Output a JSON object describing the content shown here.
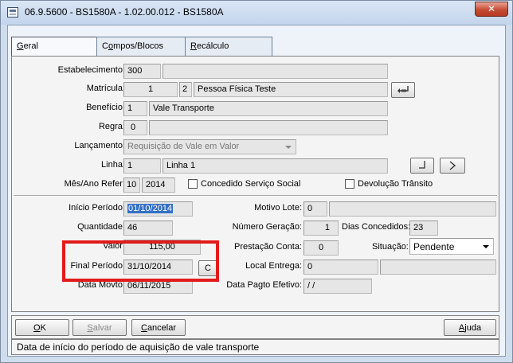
{
  "window": {
    "title": "06.9.5600 - BS1580A - 1.02.00.012 - BS1580A",
    "close": "✕"
  },
  "tabs": [
    {
      "u": "G",
      "rest": "eral"
    },
    {
      "pre": "C",
      "u": "o",
      "rest": "mpos/Blocos"
    },
    {
      "u": "R",
      "rest": "ecálculo"
    }
  ],
  "form": {
    "estabelecimento": {
      "label": "Estabelecimento:",
      "value": "300",
      "desc": ""
    },
    "matricula": {
      "label": "Matrícula:",
      "value": "1",
      "tipo": "2",
      "nome": "Pessoa Física Teste"
    },
    "beneficio": {
      "label": "Benefício:",
      "value": "1",
      "desc": "Vale Transporte"
    },
    "regra": {
      "label": "Regra:",
      "value": "0",
      "desc": ""
    },
    "lancamento": {
      "label": "Lançamento:",
      "value": "Requisição de Vale em Valor"
    },
    "linha": {
      "label": "Linha:",
      "value": "1",
      "desc": "Linha 1"
    },
    "mes_ano": {
      "label": "Mês/Ano Refer:",
      "mes": "10",
      "ano": "2014"
    },
    "concedido": {
      "label": "Concedido Serviço Social"
    },
    "devolucao": {
      "label": "Devolução Trânsito"
    },
    "inicio_periodo": {
      "label": "Início Período:",
      "value": "01/10/2014"
    },
    "quantidade": {
      "label": "Quantidade:",
      "value": "46"
    },
    "valor": {
      "label": "Valor:",
      "value": "115,00"
    },
    "final_periodo": {
      "label": "Final Período:",
      "value": "31/10/2014",
      "calc_label": "C"
    },
    "data_movto": {
      "label": "Data Movto:",
      "value": "06/11/2015"
    },
    "motivo_lote": {
      "label": "Motivo Lote:",
      "value": "0",
      "desc": ""
    },
    "numero_geracao": {
      "label": "Número Geração:",
      "value": "1"
    },
    "dias_concedidos": {
      "label": "Dias Concedidos:",
      "value": "23"
    },
    "prestacao_conta": {
      "label": "Prestação Conta:",
      "value": "0"
    },
    "situacao": {
      "label": "Situação:",
      "value": "Pendente"
    },
    "local_entrega": {
      "label": "Local Entrega:",
      "value": "0",
      "desc": ""
    },
    "data_pagto": {
      "label": "Data Pagto Efetivo:",
      "value": "/ /"
    }
  },
  "buttons": {
    "ok": {
      "u": "O",
      "rest": "K"
    },
    "salvar": {
      "u": "S",
      "rest": "alvar"
    },
    "cancelar": {
      "u": "C",
      "rest": "ancelar"
    },
    "ajuda": {
      "u": "A",
      "rest": "juda"
    }
  },
  "status": "Data de início do período de aquisição de vale transporte",
  "colors": {
    "highlight": "#e21b1b",
    "selection": "#3370c6"
  }
}
